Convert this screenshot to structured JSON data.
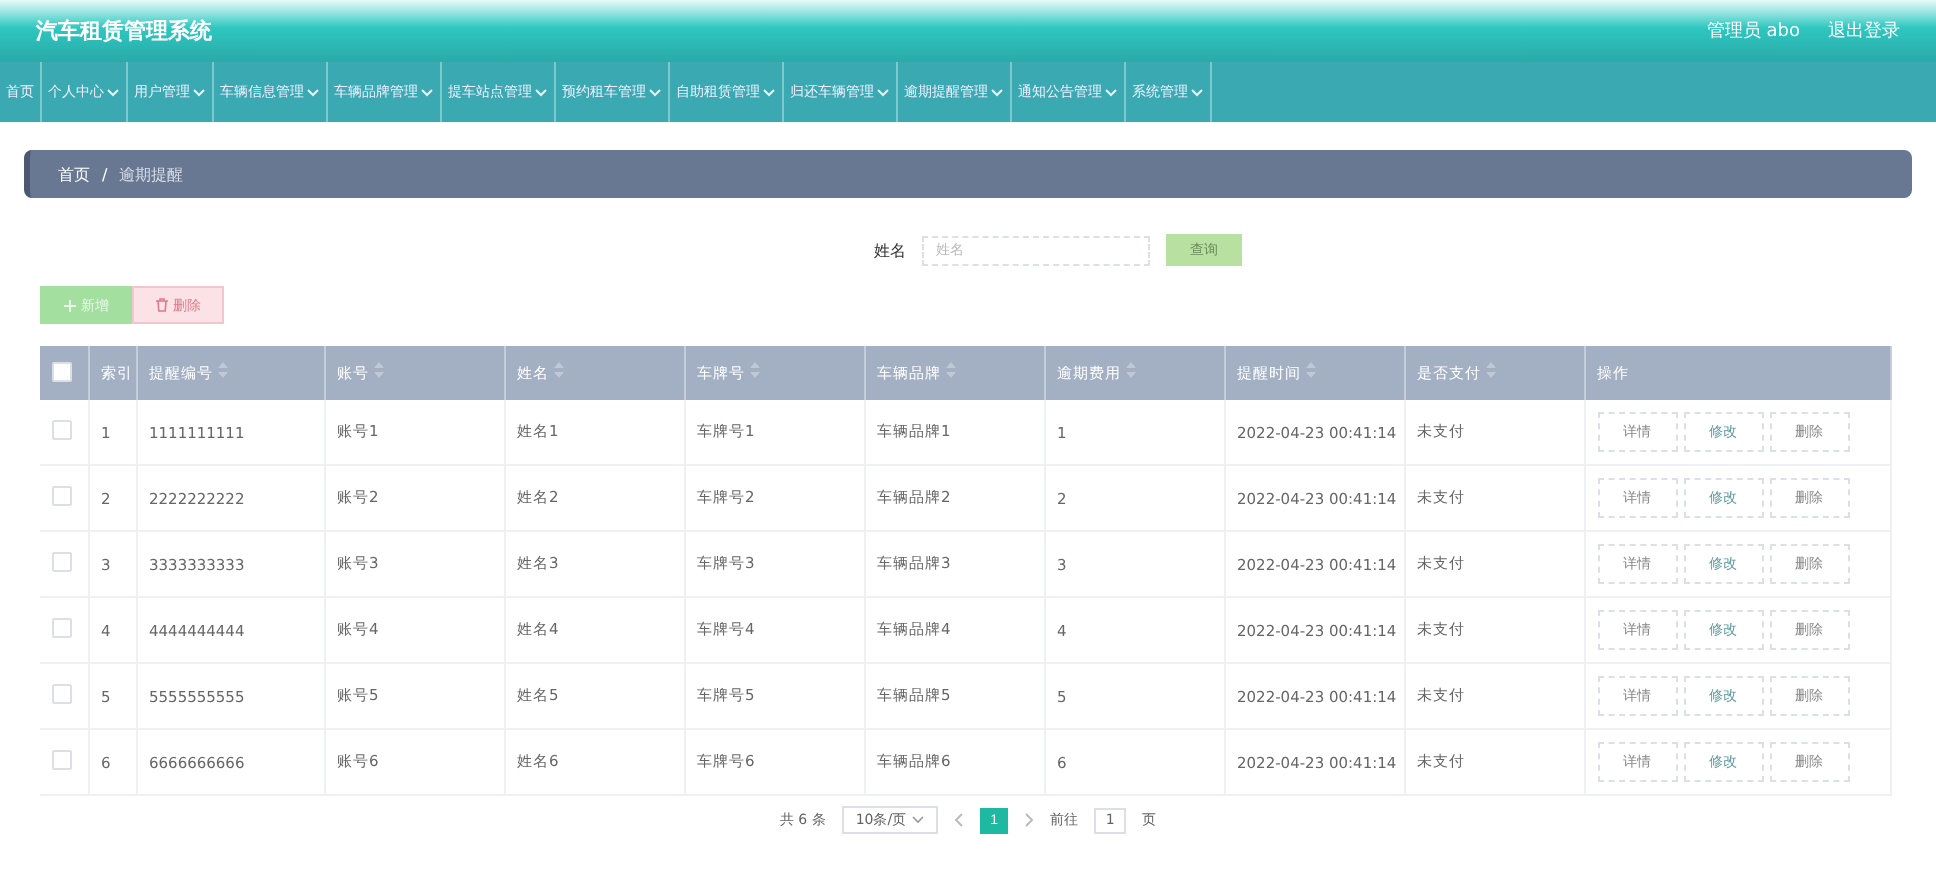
{
  "header": {
    "title": "汽车租赁管理系统",
    "user": "管理员 abo",
    "logout": "退出登录"
  },
  "nav": [
    {
      "label": "首页",
      "dropdown": false
    },
    {
      "label": "个人中心",
      "dropdown": true
    },
    {
      "label": "用户管理",
      "dropdown": true
    },
    {
      "label": "车辆信息管理",
      "dropdown": true
    },
    {
      "label": "车辆品牌管理",
      "dropdown": true
    },
    {
      "label": "提车站点管理",
      "dropdown": true
    },
    {
      "label": "预约租车管理",
      "dropdown": true
    },
    {
      "label": "自助租赁管理",
      "dropdown": true
    },
    {
      "label": "归还车辆管理",
      "dropdown": true
    },
    {
      "label": "逾期提醒管理",
      "dropdown": true
    },
    {
      "label": "通知公告管理",
      "dropdown": true
    },
    {
      "label": "系统管理",
      "dropdown": true
    }
  ],
  "breadcrumb": {
    "items": [
      "首页",
      "逾期提醒"
    ],
    "separator": "/"
  },
  "search": {
    "label": "姓名",
    "placeholder": "姓名",
    "button": "查询"
  },
  "actions": {
    "add": "新增",
    "delete": "删除"
  },
  "table": {
    "select_all_checked": false,
    "columns": [
      {
        "label": "索引",
        "sortable": false
      },
      {
        "label": "提醒编号",
        "sortable": true
      },
      {
        "label": "账号",
        "sortable": true
      },
      {
        "label": "姓名",
        "sortable": true
      },
      {
        "label": "车牌号",
        "sortable": true
      },
      {
        "label": "车辆品牌",
        "sortable": true
      },
      {
        "label": "逾期费用",
        "sortable": true
      },
      {
        "label": "提醒时间",
        "sortable": true
      },
      {
        "label": "是否支付",
        "sortable": true
      },
      {
        "label": "操作",
        "sortable": false
      }
    ],
    "rows": [
      {
        "checked": false,
        "cells": [
          "1",
          "1111111111",
          "账号1",
          "姓名1",
          "车牌号1",
          "车辆品牌1",
          "1",
          "2022-04-23 00:41:14",
          "未支付"
        ],
        "actions": [
          "详情",
          "修改",
          "删除"
        ]
      },
      {
        "checked": false,
        "cells": [
          "2",
          "2222222222",
          "账号2",
          "姓名2",
          "车牌号2",
          "车辆品牌2",
          "2",
          "2022-04-23 00:41:14",
          "未支付"
        ],
        "actions": [
          "详情",
          "修改",
          "删除"
        ]
      },
      {
        "checked": false,
        "cells": [
          "3",
          "3333333333",
          "账号3",
          "姓名3",
          "车牌号3",
          "车辆品牌3",
          "3",
          "2022-04-23 00:41:14",
          "未支付"
        ],
        "actions": [
          "详情",
          "修改",
          "删除"
        ]
      },
      {
        "checked": false,
        "cells": [
          "4",
          "4444444444",
          "账号4",
          "姓名4",
          "车牌号4",
          "车辆品牌4",
          "4",
          "2022-04-23 00:41:14",
          "未支付"
        ],
        "actions": [
          "详情",
          "修改",
          "删除"
        ]
      },
      {
        "checked": false,
        "cells": [
          "5",
          "5555555555",
          "账号5",
          "姓名5",
          "车牌号5",
          "车辆品牌5",
          "5",
          "2022-04-23 00:41:14",
          "未支付"
        ],
        "actions": [
          "详情",
          "修改",
          "删除"
        ]
      },
      {
        "checked": false,
        "cells": [
          "6",
          "6666666666",
          "账号6",
          "姓名6",
          "车牌号6",
          "车辆品牌6",
          "6",
          "2022-04-23 00:41:14",
          "未支付"
        ],
        "actions": [
          "详情",
          "修改",
          "删除"
        ]
      }
    ]
  },
  "pagination": {
    "total": "共 6 条",
    "page_size": "10条/页",
    "pages": [
      {
        "label": "1",
        "selected": true
      }
    ],
    "goto": "前往",
    "goto_value": "1",
    "goto_unit": "页"
  }
}
